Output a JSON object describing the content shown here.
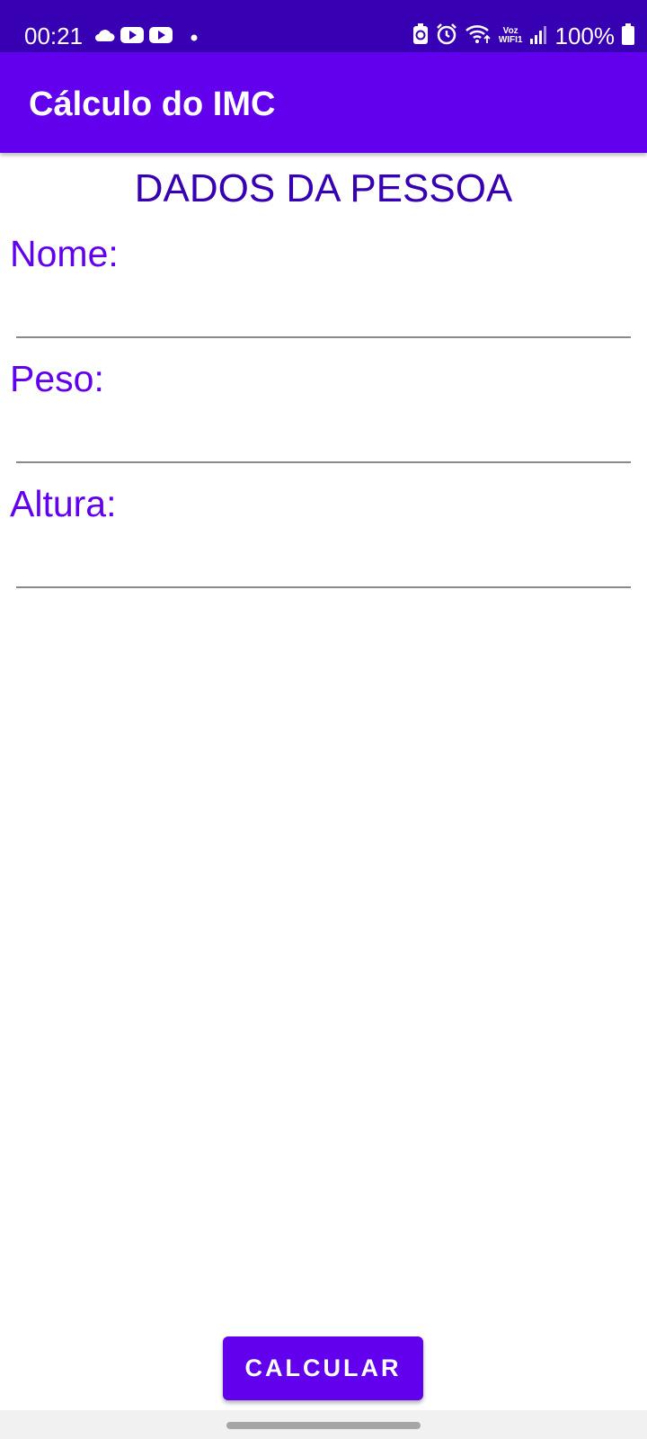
{
  "status_bar": {
    "time": "00:21",
    "battery": "100%",
    "voz_line1": "Voz",
    "voz_line2": "WIFI1",
    "left_icons": [
      "cloud-icon",
      "youtube-icon",
      "youtube-icon",
      "dot-icon"
    ],
    "right_icons": [
      "battery-saver-icon",
      "alarm-icon",
      "wifi-icon",
      "signal-icon",
      "battery-icon"
    ],
    "background": "#3700b3"
  },
  "app_bar": {
    "title": "Cálculo do IMC",
    "background": "#6200ee"
  },
  "form": {
    "section_title": "DADOS DA PESSOA",
    "fields": [
      {
        "label": "Nome:",
        "value": "",
        "placeholder": ""
      },
      {
        "label": "Peso:",
        "value": "",
        "placeholder": ""
      },
      {
        "label": "Altura:",
        "value": "",
        "placeholder": ""
      }
    ],
    "label_color": "#6200ee",
    "title_color": "#3700b3"
  },
  "actions": {
    "calculate_label": "CALCULAR",
    "button_color": "#6200ee"
  }
}
